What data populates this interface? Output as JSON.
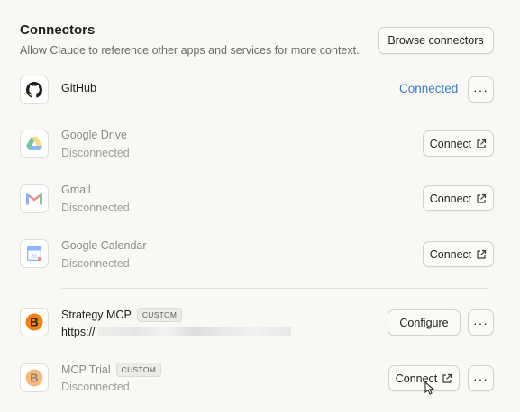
{
  "header": {
    "title": "Connectors",
    "subtitle": "Allow Claude to reference other apps and services for more context.",
    "browse_label": "Browse connectors"
  },
  "connectors": [
    {
      "name": "GitHub",
      "status": "Connected",
      "icon": "github-icon"
    },
    {
      "name": "Google Drive",
      "status": "Disconnected",
      "action": "Connect",
      "icon": "google-drive-icon"
    },
    {
      "name": "Gmail",
      "status": "Disconnected",
      "action": "Connect",
      "icon": "gmail-icon"
    },
    {
      "name": "Google Calendar",
      "status": "Disconnected",
      "action": "Connect",
      "icon": "google-calendar-icon"
    }
  ],
  "custom": [
    {
      "name": "Strategy MCP",
      "badge": "CUSTOM",
      "url_prefix": "https://",
      "action": "Configure",
      "icon": "bitcoin-icon"
    },
    {
      "name": "MCP Trial",
      "badge": "CUSTOM",
      "status": "Disconnected",
      "action": "Connect",
      "icon": "bitcoin-icon"
    }
  ],
  "more_label": "···",
  "colors": {
    "connected": "#3b7bbf",
    "bitcoin": "#f0820f",
    "background": "#f9f8f5"
  }
}
